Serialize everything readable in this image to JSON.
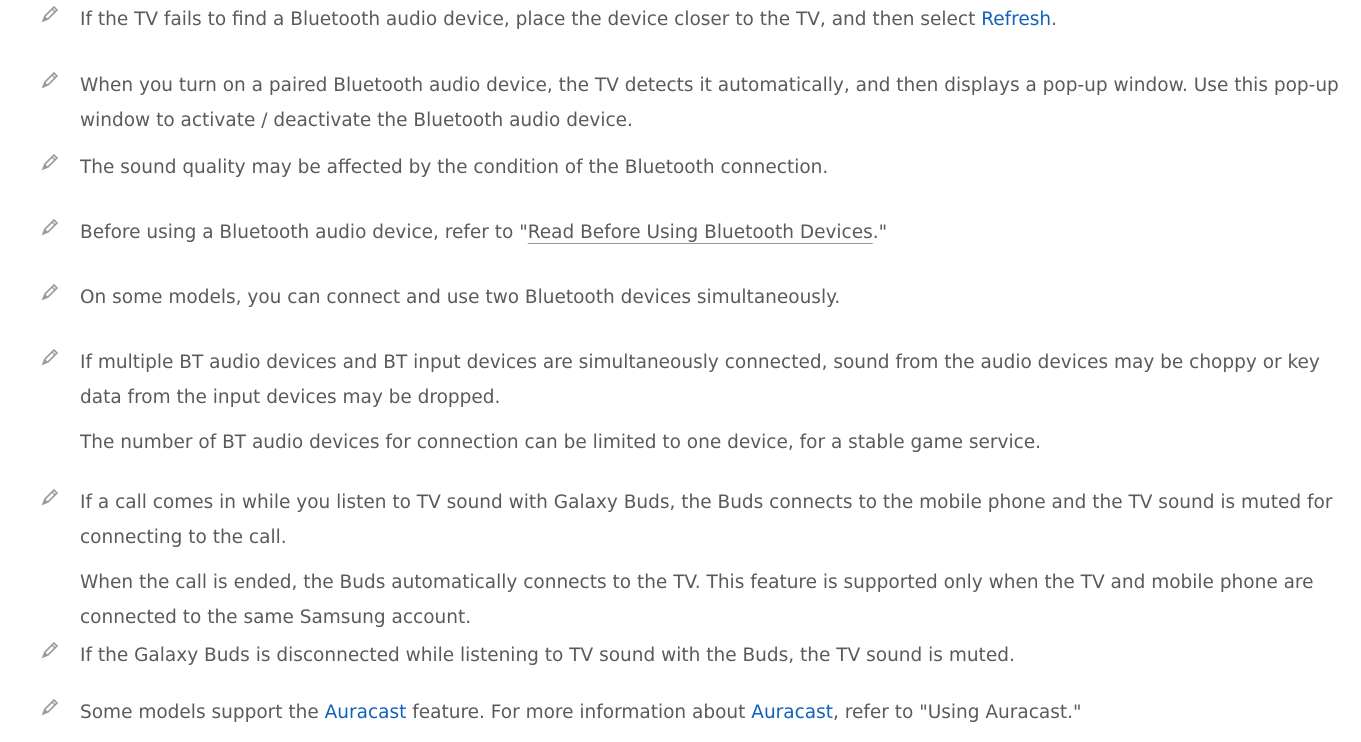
{
  "notes": [
    {
      "before": "If the TV fails to find a Bluetooth audio device, place the device closer to the TV, and then select ",
      "highlight": "Refresh",
      "after": "."
    },
    {
      "text": "When you turn on a paired Bluetooth audio device, the TV detects it automatically, and then displays a pop-up window. Use this pop-up window to activate / deactivate the Bluetooth audio device."
    },
    {
      "text": "The sound quality may be affected by the condition of the Bluetooth connection."
    },
    {
      "before": "Before using a Bluetooth audio device, refer to \"",
      "link": "Read Before Using Bluetooth Devices",
      "after": ".\""
    },
    {
      "text": "On some models, you can connect and use two Bluetooth devices simultaneously."
    },
    {
      "text": "If multiple BT audio devices and BT input devices are simultaneously connected, sound from the audio devices may be choppy or key data from the input devices may be dropped.",
      "extra": "The number of BT audio devices for connection can be limited to one device, for a stable game service."
    },
    {
      "text": "If a call comes in while you listen to TV sound with Galaxy Buds, the Buds connects to the mobile phone and the TV sound is muted for connecting to the call.",
      "extra": "When the call is ended, the Buds automatically connects to the TV. This feature is supported only when the TV and mobile phone are connected to the same Samsung account."
    },
    {
      "text": "If the Galaxy Buds is disconnected while listening to TV sound with the Buds, the TV sound is muted."
    },
    {
      "before": "Some models support the ",
      "highlight": "Auracast",
      "middle": " feature. For more information about ",
      "highlight2": "Auracast",
      "after": ", refer to \"Using Auracast.\""
    }
  ],
  "icons": {
    "note_icon": "pencil-icon"
  },
  "colors": {
    "text": "#5a5a5a",
    "highlight": "#1261b9",
    "icon": "#9a9a9a"
  }
}
